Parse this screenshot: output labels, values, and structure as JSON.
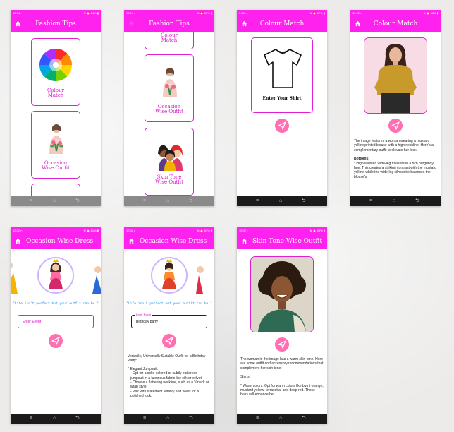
{
  "status": {
    "s1": {
      "left": "12:14 ▪",
      "right": "N ⏰ 64% ▮"
    },
    "s2": {
      "left": "12:14 ▪",
      "right": "N ⏰ 63% ▮"
    },
    "s3": {
      "left": "9:56 ▪ ▪",
      "right": "N ⏰ 87% ▮"
    },
    "s4": {
      "left": "12:22 ▪",
      "right": "N ⏰ 63% ▮"
    },
    "s5": {
      "left": "12:32 ▪ ▪",
      "right": "N ⏰ 61% ▮"
    },
    "s6": {
      "left": "12:32 ▪",
      "right": "N ⏰ 61% ▮"
    },
    "s7": {
      "left": "10:32 ▪",
      "right": "N ⏰ 80% ▮"
    }
  },
  "screen1": {
    "title": "Fashion Tips",
    "cards": [
      {
        "label_l1": "Colour",
        "label_l2": "Match"
      },
      {
        "label_l1": "Occasion",
        "label_l2": "Wise Outfit"
      }
    ]
  },
  "screen2": {
    "title": "Fashion Tips",
    "cards": [
      {
        "label_l1": "Colour",
        "label_l2": "Match"
      },
      {
        "label_l1": "Occasion",
        "label_l2": "Wise Outfit"
      },
      {
        "label_l1": "Skin Tone",
        "label_l2": "Wise Outfit"
      }
    ]
  },
  "screen3": {
    "title": "Colour Match",
    "upload_label": "Enter Your Shirt"
  },
  "screen4": {
    "title": "Colour Match",
    "intro": "The image features a woman wearing a mustard yellow printed blouse with a high neckline.  Here's a complementary outfit to elevate her look:",
    "heading": "Bottoms:",
    "bullet": "* High-waisted wide-leg trousers in a rich burgundy hue. This creates a striking contrast with the mustard yellow, while the wide-leg silhouette balances the blouse's"
  },
  "screen5": {
    "title": "Occasion Wise Dress",
    "quote": "\"Life isn't perfect but your outfit can be.\"",
    "input_placeholder": "Enter Event"
  },
  "screen6": {
    "title": "Occasion Wise Dress",
    "quote": "\"Life isn't perfect but your outfit can be.\"",
    "input_label": "Enter Event",
    "input_value": "Birthday party",
    "result": {
      "title": "Versatile, Universally Suitable Outfit for a Birthday Party:",
      "item": "* Elegant Jumpsuit:",
      "l1": "- Opt for a solid-colored or subtly patterned jumpsuit in a luxurious fabric like silk or velvet.",
      "l2": "- Choose a flattering neckline, such as a V-neck or wrap style.",
      "l3": "- Pair with statement jewelry and heels for a polished look."
    }
  },
  "screen7": {
    "title": "Skin Tone Wise Outfit",
    "intro": "The woman in the image has a warm skin tone. Here are some outfit and accessory recommendations that complement her skin tone:",
    "heading": "Shirts:",
    "bullet": "* Warm colors: Opt for warm colors like burnt orange, mustard yellow, terracotta, and deep red. These hues will enhance her"
  },
  "nav": {
    "left": "≡",
    "center": "⌂",
    "right": "⮌"
  },
  "colors": {
    "accent": "#ff22ee",
    "card_border": "#e020d0",
    "send": "#ff6fb1",
    "quote": "#1a8fe0"
  }
}
